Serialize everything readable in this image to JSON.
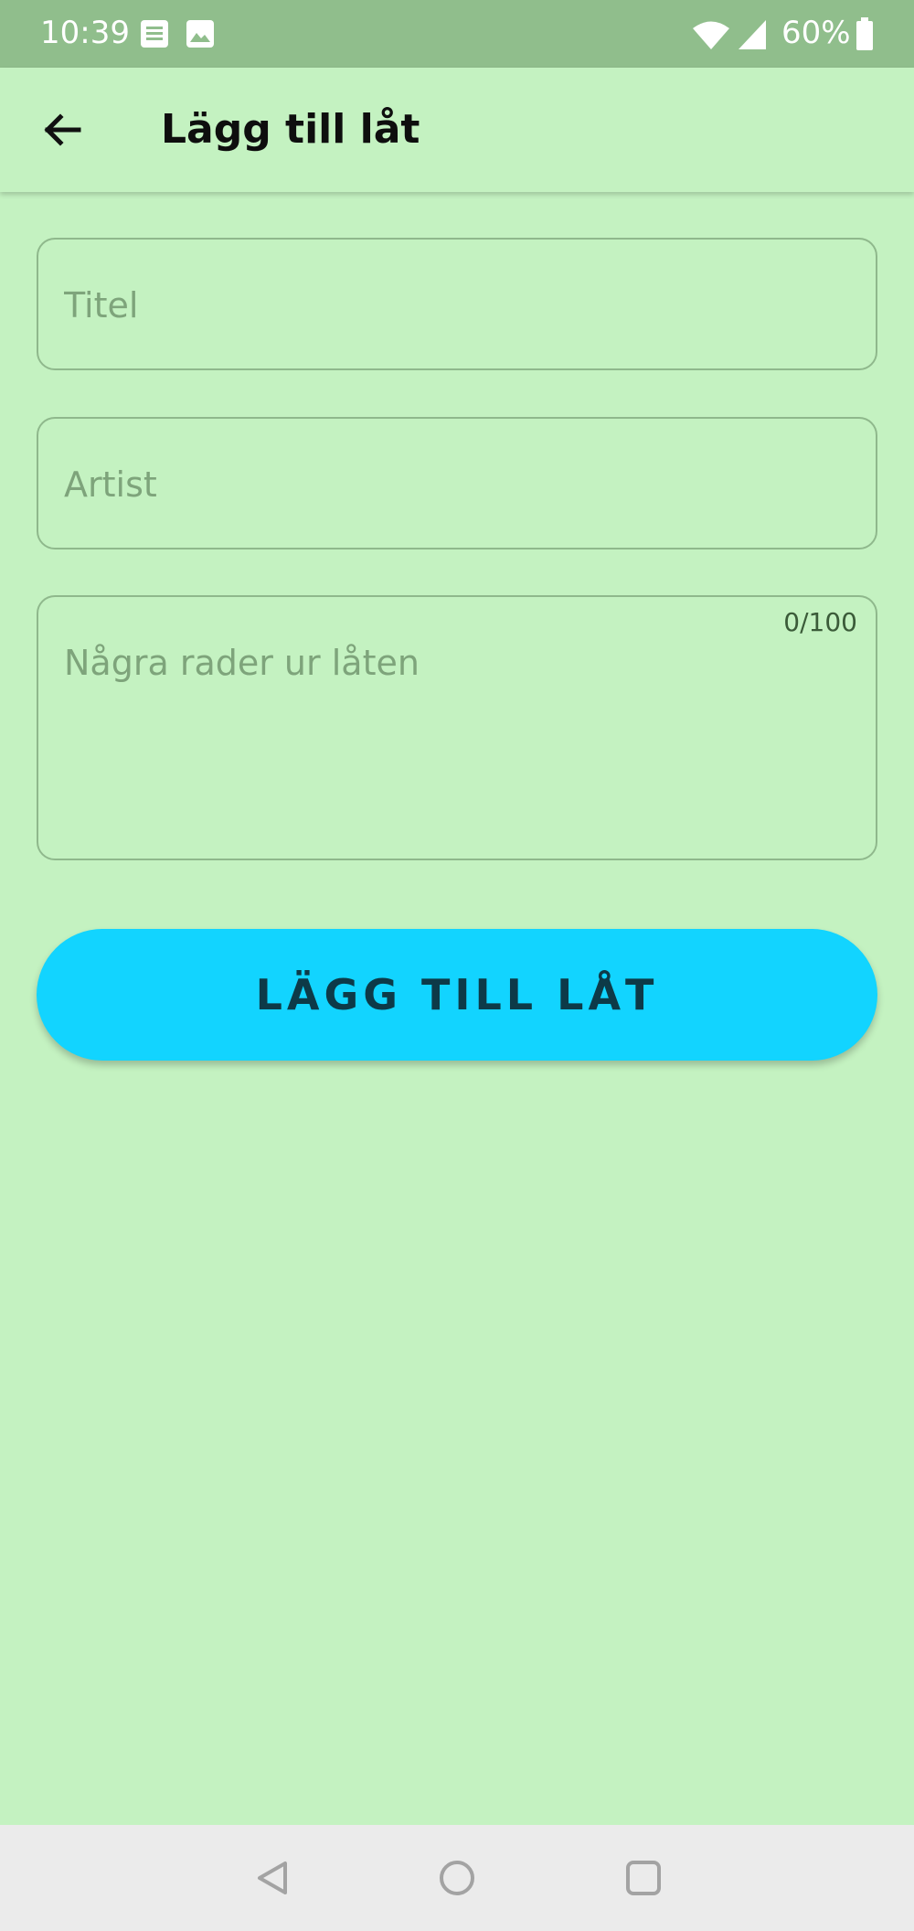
{
  "status_bar": {
    "time": "10:39",
    "battery": "60%",
    "background": "#90be8c",
    "icons": [
      "notes-notification-icon",
      "image-notification-icon",
      "wifi-icon",
      "cell-signal-icon",
      "battery-icon"
    ]
  },
  "app_bar": {
    "title": "Lägg till låt",
    "back_icon": "arrow-back-icon"
  },
  "form": {
    "title_field": {
      "placeholder": "Titel",
      "value": ""
    },
    "artist_field": {
      "placeholder": "Artist",
      "value": ""
    },
    "lyrics_field": {
      "placeholder": "Några rader ur låten",
      "value": "",
      "counter": "0/100"
    },
    "submit_label": "LÄGG TILL LÅT"
  },
  "nav_bar": {
    "icons": [
      "nav-back-icon",
      "nav-home-icon",
      "nav-recents-icon"
    ]
  },
  "colors": {
    "background": "#c4f2c1",
    "accent": "#12d4ff",
    "button_text": "#0d3a48",
    "field_border": "#8fb88c",
    "placeholder": "#7ea47b",
    "nav_bar": "#ebebeb"
  }
}
